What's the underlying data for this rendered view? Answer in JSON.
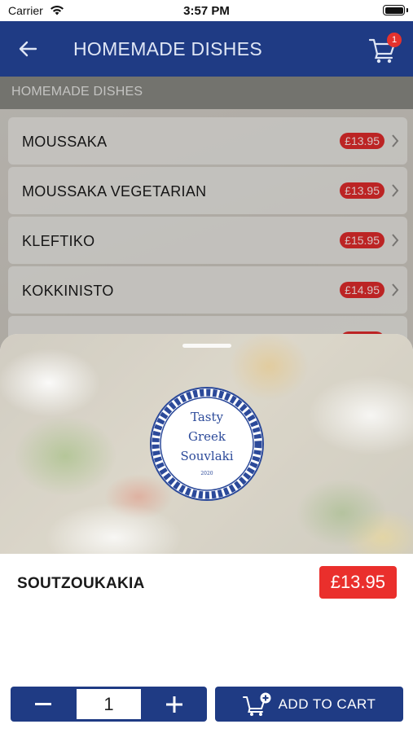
{
  "status_bar": {
    "carrier": "Carrier",
    "time": "3:57 PM"
  },
  "navbar": {
    "title": "HOMEMADE DISHES",
    "cart_count": "1",
    "back_icon": "back-arrow-icon",
    "cart_icon": "cart-icon"
  },
  "section": {
    "header": "HOMEMADE DISHES"
  },
  "menu_items": [
    {
      "name": "MOUSSAKA",
      "price": "£13.95"
    },
    {
      "name": "MOUSSAKA VEGETARIAN",
      "price": "£13.95"
    },
    {
      "name": "KLEFTIKO",
      "price": "£15.95"
    },
    {
      "name": "KOKKINISTO",
      "price": "£14.95"
    }
  ],
  "logo": {
    "line1": "Tasty",
    "line2": "Greek",
    "line3": "Souvlaki",
    "year": "2020"
  },
  "product": {
    "name": "SOUTZOUKAKIA",
    "price": "£13.95"
  },
  "quantity": {
    "value": "1"
  },
  "add_to_cart": {
    "label": "ADD TO CART"
  },
  "colors": {
    "navy": "#1f3b84",
    "price_red": "#ea2f2c"
  }
}
